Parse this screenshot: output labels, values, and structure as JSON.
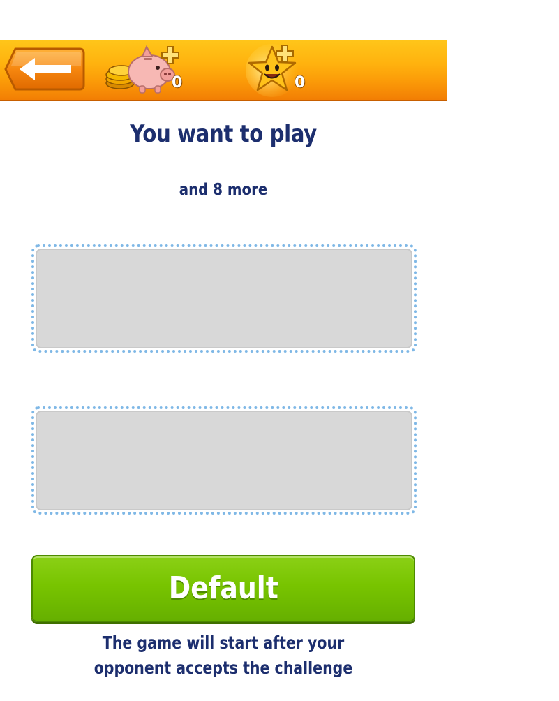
{
  "header": {
    "back_icon": "left-arrow-icon",
    "coins": {
      "icon": "piggy-bank-coins-icon",
      "count": "0"
    },
    "stars": {
      "icon": "smiling-star-icon",
      "count": "0"
    },
    "colors": {
      "bar_top": "#ffc61a",
      "bar_bottom": "#f27e04",
      "back_button": "#f58a10"
    }
  },
  "main": {
    "title": "You want to play",
    "subtitle": "and 8 more",
    "slots": [
      {
        "label": ""
      },
      {
        "label": ""
      }
    ]
  },
  "default_button": {
    "label": "Default",
    "color": "#78c400"
  },
  "footer": {
    "note": "The game will start after your opponent accepts the challenge"
  },
  "colors": {
    "text": "#1c2e6e",
    "slot_border": "#7fb8e6",
    "slot_fill": "#d8d8d8"
  }
}
